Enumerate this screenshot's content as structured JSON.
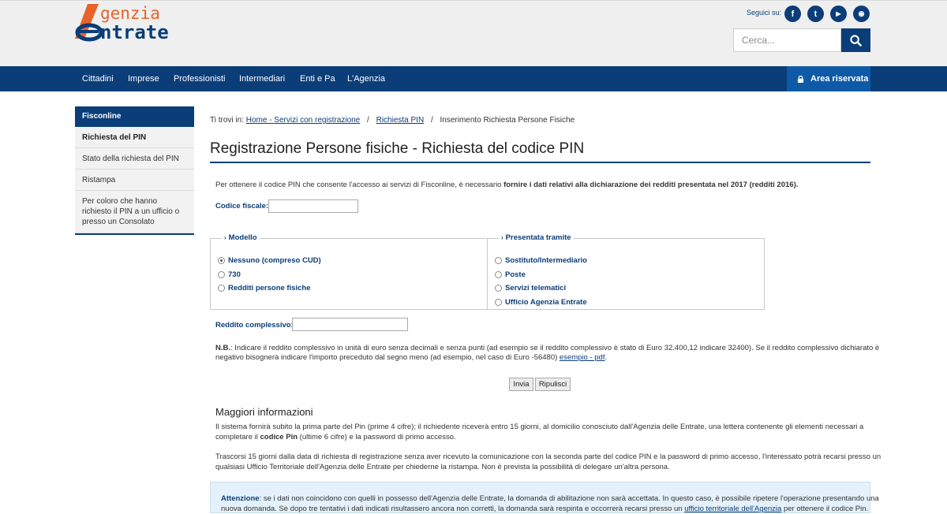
{
  "header": {
    "logo_line1": "genzia",
    "logo_line2": "ntrate",
    "social_label": "Seguici su:",
    "social": [
      {
        "icon": "facebook-icon",
        "glyph": "f"
      },
      {
        "icon": "twitter-icon",
        "glyph": "t"
      },
      {
        "icon": "youtube-icon",
        "glyph": "▶"
      },
      {
        "icon": "rss-icon",
        "glyph": "◉"
      }
    ],
    "search_placeholder": "Cerca..."
  },
  "nav": {
    "items": [
      "Cittadini",
      "Imprese",
      "Professionisti",
      "Intermediari",
      "Enti e Pa",
      "L'Agenzia"
    ],
    "area_riservata": "Area riservata"
  },
  "sidebar": {
    "title": "Fisconline",
    "items": [
      {
        "label": "Richiesta del PIN"
      },
      {
        "label": "Stato della richiesta del PIN"
      },
      {
        "label": "Ristampa"
      },
      {
        "label": "Per coloro che hanno richiesto il PIN a un ufficio o presso un Consolato"
      }
    ]
  },
  "breadcrumb": {
    "prefix": "Ti trovi in:",
    "link1": "Home - Servizi con registrazione",
    "link2": "Richiesta PIN",
    "current": "Inserimento Richiesta Persone Fisiche"
  },
  "page_title": "Registrazione Persone fisiche - Richiesta del codice PIN",
  "form": {
    "intro_plain": "Per ottenere il codice PIN che consente l'accesso ai servizi di Fisconline, è necessario ",
    "intro_bold": "fornire i dati relativi alla dichiarazione dei redditi presentata nel 2017 (redditi 2016).",
    "codice_fiscale_label": "Codice fiscale:",
    "modello_legend": "Modello",
    "modello_options": [
      {
        "label": "Nessuno (compreso CUD)",
        "selected": true
      },
      {
        "label": "730",
        "selected": false
      },
      {
        "label": "Redditi persone fisiche",
        "selected": false
      }
    ],
    "presentata_legend": "Presentata tramite",
    "presentata_options": [
      {
        "label": "Sostituto/Intermediario"
      },
      {
        "label": "Poste"
      },
      {
        "label": "Servizi telematici"
      },
      {
        "label": "Ufficio Agenzia Entrate"
      }
    ],
    "reddito_label": "Reddito complessivo:",
    "nb_bold": "N.B.",
    "nb_line1": ": Indicare il reddito complessivo in unità di euro senza decimali e senza punti (ad esempio se il reddito complessivo è stato di Euro 32.400,12 indicare 32400). Se il reddito complessivo dichiarato è",
    "nb_line2": "negativo bisognerà indicare l'importo preceduto dal segno meno (ad esempio, nel caso di Euro -56480) ",
    "nb_link": "esempio - pdf",
    "nb_end": ".",
    "submit_label": "Invia",
    "reset_label": "Ripulisci"
  },
  "info": {
    "heading": "Maggiori informazioni",
    "p1_line1": "Il sistema fornirà subito la prima parte del Pin (prime 4 cifre); il richiedente riceverà entro 15 giorni, al domicilio conosciuto dall'Agenzia delle Entrate, una lettera contenente gli elementi necessari a",
    "p1_line2_a": "completare il ",
    "p1_line2_bold": "codice Pin",
    "p1_line2_b": " (ultime 6 cifre) e la password di primo accesso.",
    "p2_line1": "Trascorsi 15 giorni dalla data di richiesta di registrazione senza aver ricevuto la comunicazione con la seconda parte del codice PIN e la password di primo accesso, l'interessato potrà recarsi presso un",
    "p2_line2": "qualsiasi Ufficio Territoriale dell'Agenzia delle Entrate per chiederne la ristampa. Non è prevista la possibilità di delegare un'altra persona."
  },
  "attention": {
    "bold": "Attenzione",
    "line1": ": se i dati non coincidono con quelli in possesso dell'Agenzia delle Entrate, la domanda di abilitazione non sarà accettata. In questo caso, è possibile ripetere l'operazione presentando una",
    "line2_a": "nuova domanda. Se dopo tre tentativi i dati indicati risultassero ancora non corretti, la domanda sarà respinta e occorrerà recarsi presso un ",
    "line2_link": "ufficio territoriale dell'Agenzia",
    "line2_b": " per ottenere il codice Pin."
  },
  "colors": {
    "brand_blue": "#0b3d78",
    "accent_orange": "#e8622a",
    "area_riservata_bg": "#0e5aa7",
    "attention_bg": "#e4f1fa"
  }
}
